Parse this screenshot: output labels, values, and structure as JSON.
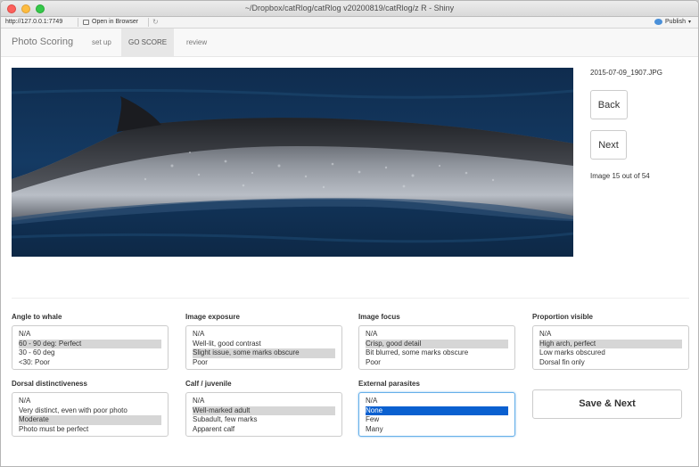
{
  "window": {
    "title": "~/Dropbox/catRlog/catRlog v20200819/catRlog/z R - Shiny"
  },
  "browser": {
    "address": "http://127.0.0.1:7749",
    "open_in_browser": "Open in Browser",
    "publish": "Publish"
  },
  "navbar": {
    "brand": "Photo Scoring",
    "tabs": [
      {
        "label": "set up",
        "active": false
      },
      {
        "label": "GO SCORE",
        "active": true
      },
      {
        "label": "review",
        "active": false
      }
    ]
  },
  "photo": {
    "filename": "2015-07-09_1907.JPG",
    "back_label": "Back",
    "next_label": "Next",
    "counter_text": "Image 15 out of 54"
  },
  "fields": [
    {
      "label": "Angle to whale",
      "options": [
        "N/A",
        "60 - 90 deg: Perfect",
        "30 - 60 deg",
        "<30: Poor"
      ],
      "selected": 1
    },
    {
      "label": "Image exposure",
      "options": [
        "N/A",
        "Well-lit, good contrast",
        "Slight issue, some marks obscure",
        "Poor"
      ],
      "selected": 2
    },
    {
      "label": "Image focus",
      "options": [
        "N/A",
        "Crisp, good detail",
        "Bit blurred, some marks obscure",
        "Poor"
      ],
      "selected": 1
    },
    {
      "label": "Proportion visible",
      "options": [
        "N/A",
        "High arch, perfect",
        "Low marks obscured",
        "Dorsal fin only"
      ],
      "selected": 1
    },
    {
      "label": "Dorsal distinctiveness",
      "options": [
        "N/A",
        "Very distinct, even with poor photo",
        "Moderate",
        "Photo must be perfect"
      ],
      "selected": 2
    },
    {
      "label": "Calf / juvenile",
      "options": [
        "N/A",
        "Well-marked adult",
        "Subadult, few marks",
        "Apparent calf"
      ],
      "selected": 1
    },
    {
      "label": "External parasites",
      "options": [
        "N/A",
        "None",
        "Few",
        "Many"
      ],
      "selected": 1
    }
  ],
  "save_next_label": "Save & Next"
}
